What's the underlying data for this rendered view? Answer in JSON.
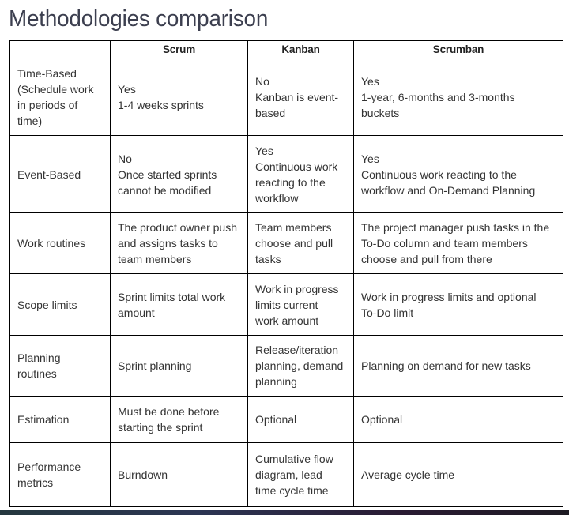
{
  "page": {
    "title": "Methodologies comparison"
  },
  "table": {
    "headers": [
      "",
      "Scrum",
      "Kanban",
      "Scrumban"
    ],
    "rows": [
      {
        "label": [
          "Time-Based",
          "(Schedule work",
          "in periods of",
          "time)"
        ],
        "scrum": [
          "Yes",
          "1-4 weeks sprints"
        ],
        "kanban": [
          "No",
          "Kanban is event-",
          "based"
        ],
        "scrumban": [
          "Yes",
          "1-year, 6-months and 3-months",
          "buckets"
        ]
      },
      {
        "label": [
          "Event-Based"
        ],
        "scrum": [
          "No",
          "Once started sprints",
          "cannot be modified"
        ],
        "kanban": [
          "Yes",
          "Continuous work",
          "reacting to the",
          "workflow"
        ],
        "scrumban": [
          "Yes",
          "Continuous work reacting to the",
          "workflow and On-Demand Planning"
        ]
      },
      {
        "label": [
          "Work routines"
        ],
        "scrum": [
          "The product owner push",
          "and assigns tasks to",
          "team members"
        ],
        "kanban": [
          "Team members",
          "choose and pull",
          "tasks"
        ],
        "scrumban": [
          "The project manager push tasks in the",
          "To-Do column and team members",
          "choose and pull from there"
        ]
      },
      {
        "label": [
          "Scope limits"
        ],
        "scrum": [
          "Sprint limits total work",
          "amount"
        ],
        "kanban": [
          "Work in progress",
          "limits current",
          "work amount"
        ],
        "scrumban": [
          "Work in progress limits and optional",
          "To-Do limit"
        ]
      },
      {
        "label": [
          "Planning",
          "routines"
        ],
        "scrum": [
          "Sprint planning"
        ],
        "kanban": [
          "Release/iteration",
          "planning, demand",
          "planning"
        ],
        "scrumban": [
          "Planning on demand for new tasks"
        ]
      },
      {
        "label": [
          "Estimation"
        ],
        "scrum": [
          "Must be done before",
          "starting the sprint"
        ],
        "kanban": [
          "Optional"
        ],
        "scrumban": [
          "Optional"
        ]
      },
      {
        "label": [
          "Performance",
          "metrics"
        ],
        "scrum": [
          "Burndown"
        ],
        "kanban": [
          "Cumulative flow",
          "diagram, lead",
          "time cycle time"
        ],
        "scrumban": [
          "Average cycle time"
        ]
      }
    ]
  },
  "colors": {
    "title": "#3c3f4f",
    "text": "#333333",
    "border": "#000000"
  }
}
